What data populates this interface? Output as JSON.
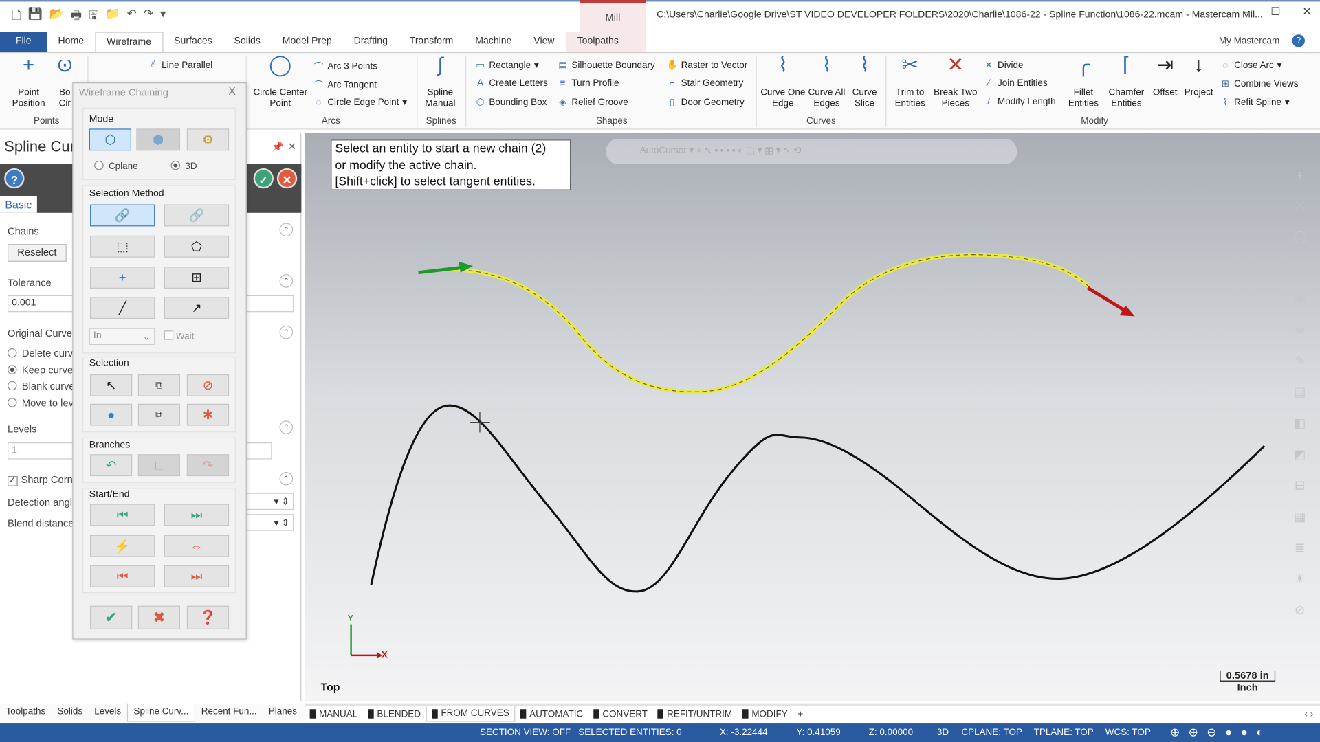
{
  "window": {
    "title": "C:\\Users\\Charlie\\Google Drive\\ST VIDEO DEVELOPER FOLDERS\\2020\\Charlie\\1086-22 - Spline Function\\1086-22.mcam - Mastercam Mil...",
    "context_tab": "Mill",
    "minimize": "–",
    "maximize": "☐",
    "close": "✕"
  },
  "ribbon_tabs": [
    "File",
    "Home",
    "Wireframe",
    "Surfaces",
    "Solids",
    "Model Prep",
    "Drafting",
    "Transform",
    "Machine",
    "View",
    "Toolpaths"
  ],
  "my_mastercam": "My Mastercam",
  "ribbon": {
    "points": {
      "label": "Points",
      "point_position": "Point Position",
      "bolt_circle": "Bo Cir"
    },
    "lines": {
      "line_parallel": "Line Parallel"
    },
    "arcs": {
      "label": "Arcs",
      "circle_center_point": "Circle Center Point",
      "arc_3_points": "Arc 3 Points",
      "arc_tangent": "Arc Tangent",
      "circle_edge_point": "Circle Edge Point"
    },
    "splines": {
      "label": "Splines",
      "spline_manual": "Spline Manual"
    },
    "shapes": {
      "label": "Shapes",
      "rectangle": "Rectangle",
      "create_letters": "Create Letters",
      "bounding_box": "Bounding Box",
      "silhouette_boundary": "Silhouette Boundary",
      "turn_profile": "Turn Profile",
      "relief_groove": "Relief Groove",
      "raster_to_vector": "Raster to Vector",
      "stair_geometry": "Stair Geometry",
      "door_geometry": "Door Geometry"
    },
    "curves": {
      "label": "Curves",
      "curve_one_edge": "Curve One Edge",
      "curve_all_edges": "Curve All Edges",
      "curve_slice": "Curve Slice"
    },
    "modify": {
      "label": "Modify",
      "trim_to_entities": "Trim to Entities",
      "break_two_pieces": "Break Two Pieces",
      "divide": "Divide",
      "join_entities": "Join Entities",
      "modify_length": "Modify Length",
      "fillet_entities": "Fillet Entities",
      "chamfer_entities": "Chamfer Entities",
      "offset": "Offset",
      "project": "Project",
      "close_arc": "Close Arc",
      "combine_views": "Combine Views",
      "refit_spline": "Refit Spline"
    }
  },
  "left_panel": {
    "title": "Spline Cur",
    "tab": "Basic",
    "chains_label": "Chains",
    "reselect": "Reselect",
    "tolerance_label": "Tolerance",
    "tolerance_value": "0.001",
    "original_curves_label": "Original Curves",
    "options": [
      "Delete curve",
      "Keep curves",
      "Blank curves",
      "Move to lev"
    ],
    "selected_option": 1,
    "levels_label": "Levels",
    "levels_value": "1",
    "sharp_corners": "Sharp Corn",
    "sharp_checked": true,
    "detection_angle": "Detection angl",
    "blend_distance": "Blend distance"
  },
  "chaining": {
    "title": "Wireframe Chaining",
    "close": "X",
    "mode_label": "Mode",
    "cplane": "Cplane",
    "three_d": "3D",
    "mode_selected": "3D",
    "selection_method_label": "Selection Method",
    "in_value": "In",
    "wait": "Wait",
    "selection_label": "Selection",
    "branches_label": "Branches",
    "start_end_label": "Start/End"
  },
  "viewport": {
    "prompt": [
      "Select an entity to start a new chain (2)",
      "or modify the active chain.",
      "[Shift+click] to select tangent entities."
    ],
    "autocursor": "AutoCursor",
    "view_name": "Top",
    "scale_value": "0.5678 in",
    "scale_unit": "Inch",
    "axis_x": "X",
    "axis_y": "Y",
    "colors": {
      "chain": "#e8e84a",
      "start_arrow": "#1e9a2a",
      "end_arrow": "#c0161b",
      "curve": "#111111"
    }
  },
  "bottom_tabs": [
    "Toolpaths",
    "Solids",
    "Levels",
    "Spline Curv...",
    "Recent Fun...",
    "Planes"
  ],
  "bottom_active": 3,
  "view_tabs": [
    "MANUAL",
    "BLENDED",
    "FROM CURVES",
    "AUTOMATIC",
    "CONVERT",
    "REFIT/UNTRIM",
    "MODIFY"
  ],
  "view_tabs_add": "+",
  "status": {
    "section_view": "SECTION VIEW: OFF",
    "selected_entities": "SELECTED ENTITIES: 0",
    "x": "X:  -3.22444",
    "y": "Y:  0.41059",
    "z": "Z:  0.00000",
    "mode": "3D",
    "cplane": "CPLANE: TOP",
    "tplane": "TPLANE: TOP",
    "wcs": "WCS: TOP"
  }
}
